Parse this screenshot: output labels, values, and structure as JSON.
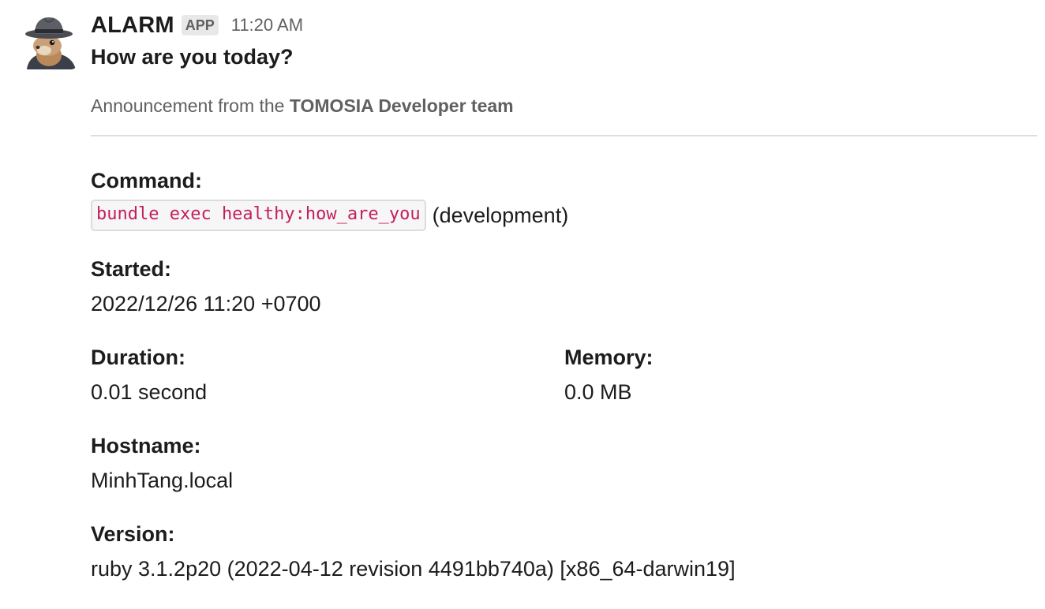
{
  "message": {
    "sender": "ALARM",
    "badge": "APP",
    "timestamp": "11:20 AM",
    "title": "How are you today?"
  },
  "context": {
    "prefix": "Announcement from the",
    "team": "TOMOSIA Developer team"
  },
  "fields": {
    "command": {
      "label": "Command:",
      "code": "bundle exec healthy:how_are_you",
      "env": "(development)"
    },
    "started": {
      "label": "Started:",
      "value": "2022/12/26 11:20 +0700"
    },
    "duration": {
      "label": "Duration:",
      "value": "0.01 second"
    },
    "memory": {
      "label": "Memory:",
      "value": "0.0 MB"
    },
    "hostname": {
      "label": "Hostname:",
      "value": "MinhTang.local"
    },
    "version": {
      "label": "Version:",
      "value": "ruby 3.1.2p20 (2022-04-12 revision 4491bb740a) [x86_64-darwin19]"
    }
  },
  "colors": {
    "code_text": "#c41e5c",
    "muted_text": "#616061",
    "divider": "#dddddd"
  },
  "icons": {
    "avatar": "squirrel-with-fedora-avatar"
  }
}
